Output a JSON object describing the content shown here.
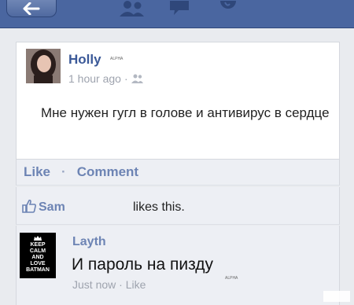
{
  "header": {
    "back_icon": "back-arrow-icon",
    "nav_icons": [
      "friend-requests-icon",
      "messages-icon",
      "notifications-globe-icon"
    ],
    "bar_color": "#4a66a0"
  },
  "post": {
    "author": "Holly",
    "author_badge": "ALPHA",
    "time": "1 hour ago",
    "dot": "·",
    "privacy_icon": "friends-icon",
    "text": "Мне нужен гугл в голове и антивирус в сердце"
  },
  "actions": {
    "like": "Like",
    "separator": "·",
    "comment": "Comment"
  },
  "likes": {
    "icon": "thumbs-up-icon",
    "name": "Sam",
    "text": "likes this."
  },
  "comment": {
    "avatar_lines": [
      "KEEP",
      "CALM",
      "AND",
      "LOVE",
      "BATMAN"
    ],
    "author": "Layth",
    "text": "И пароль на пиздy",
    "badge": "ALPHA",
    "meta": "Just now · Like"
  },
  "colors": {
    "link": "#6d84b4",
    "author": "#3b5998",
    "muted": "#9ea3ae"
  }
}
